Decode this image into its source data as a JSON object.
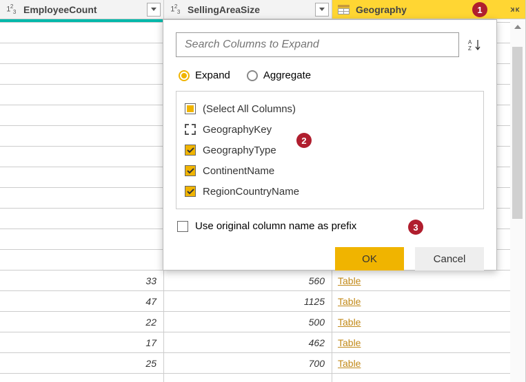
{
  "columns": {
    "employee": {
      "label": "EmployeeCount",
      "type": "123"
    },
    "selling": {
      "label": "SellingAreaSize",
      "type": "123"
    },
    "geo": {
      "label": "Geography",
      "type": "table"
    }
  },
  "rows": {
    "employee": [
      "",
      "",
      "",
      "",
      "",
      "",
      "",
      "",
      "",
      "",
      "",
      "",
      "33",
      "47",
      "22",
      "17",
      "25",
      ""
    ],
    "selling": [
      "",
      "",
      "",
      "",
      "",
      "",
      "",
      "",
      "",
      "",
      "",
      "",
      "560",
      "1125",
      "500",
      "462",
      "700",
      ""
    ],
    "geo": [
      "",
      "",
      "",
      "",
      "",
      "",
      "",
      "",
      "",
      "",
      "",
      "",
      "Table",
      "Table",
      "Table",
      "Table",
      "Table",
      ""
    ]
  },
  "popup": {
    "search_placeholder": "Search Columns to Expand",
    "expand_label": "Expand",
    "aggregate_label": "Aggregate",
    "select_all_label": "(Select All Columns)",
    "items": {
      "geokey": "GeographyKey",
      "geotype": "GeographyType",
      "continent": "ContinentName",
      "region": "RegionCountryName"
    },
    "prefix_label": "Use original column name as prefix",
    "ok_label": "OK",
    "cancel_label": "Cancel"
  },
  "callouts": {
    "c1": "1",
    "c2": "2",
    "c3": "3"
  }
}
